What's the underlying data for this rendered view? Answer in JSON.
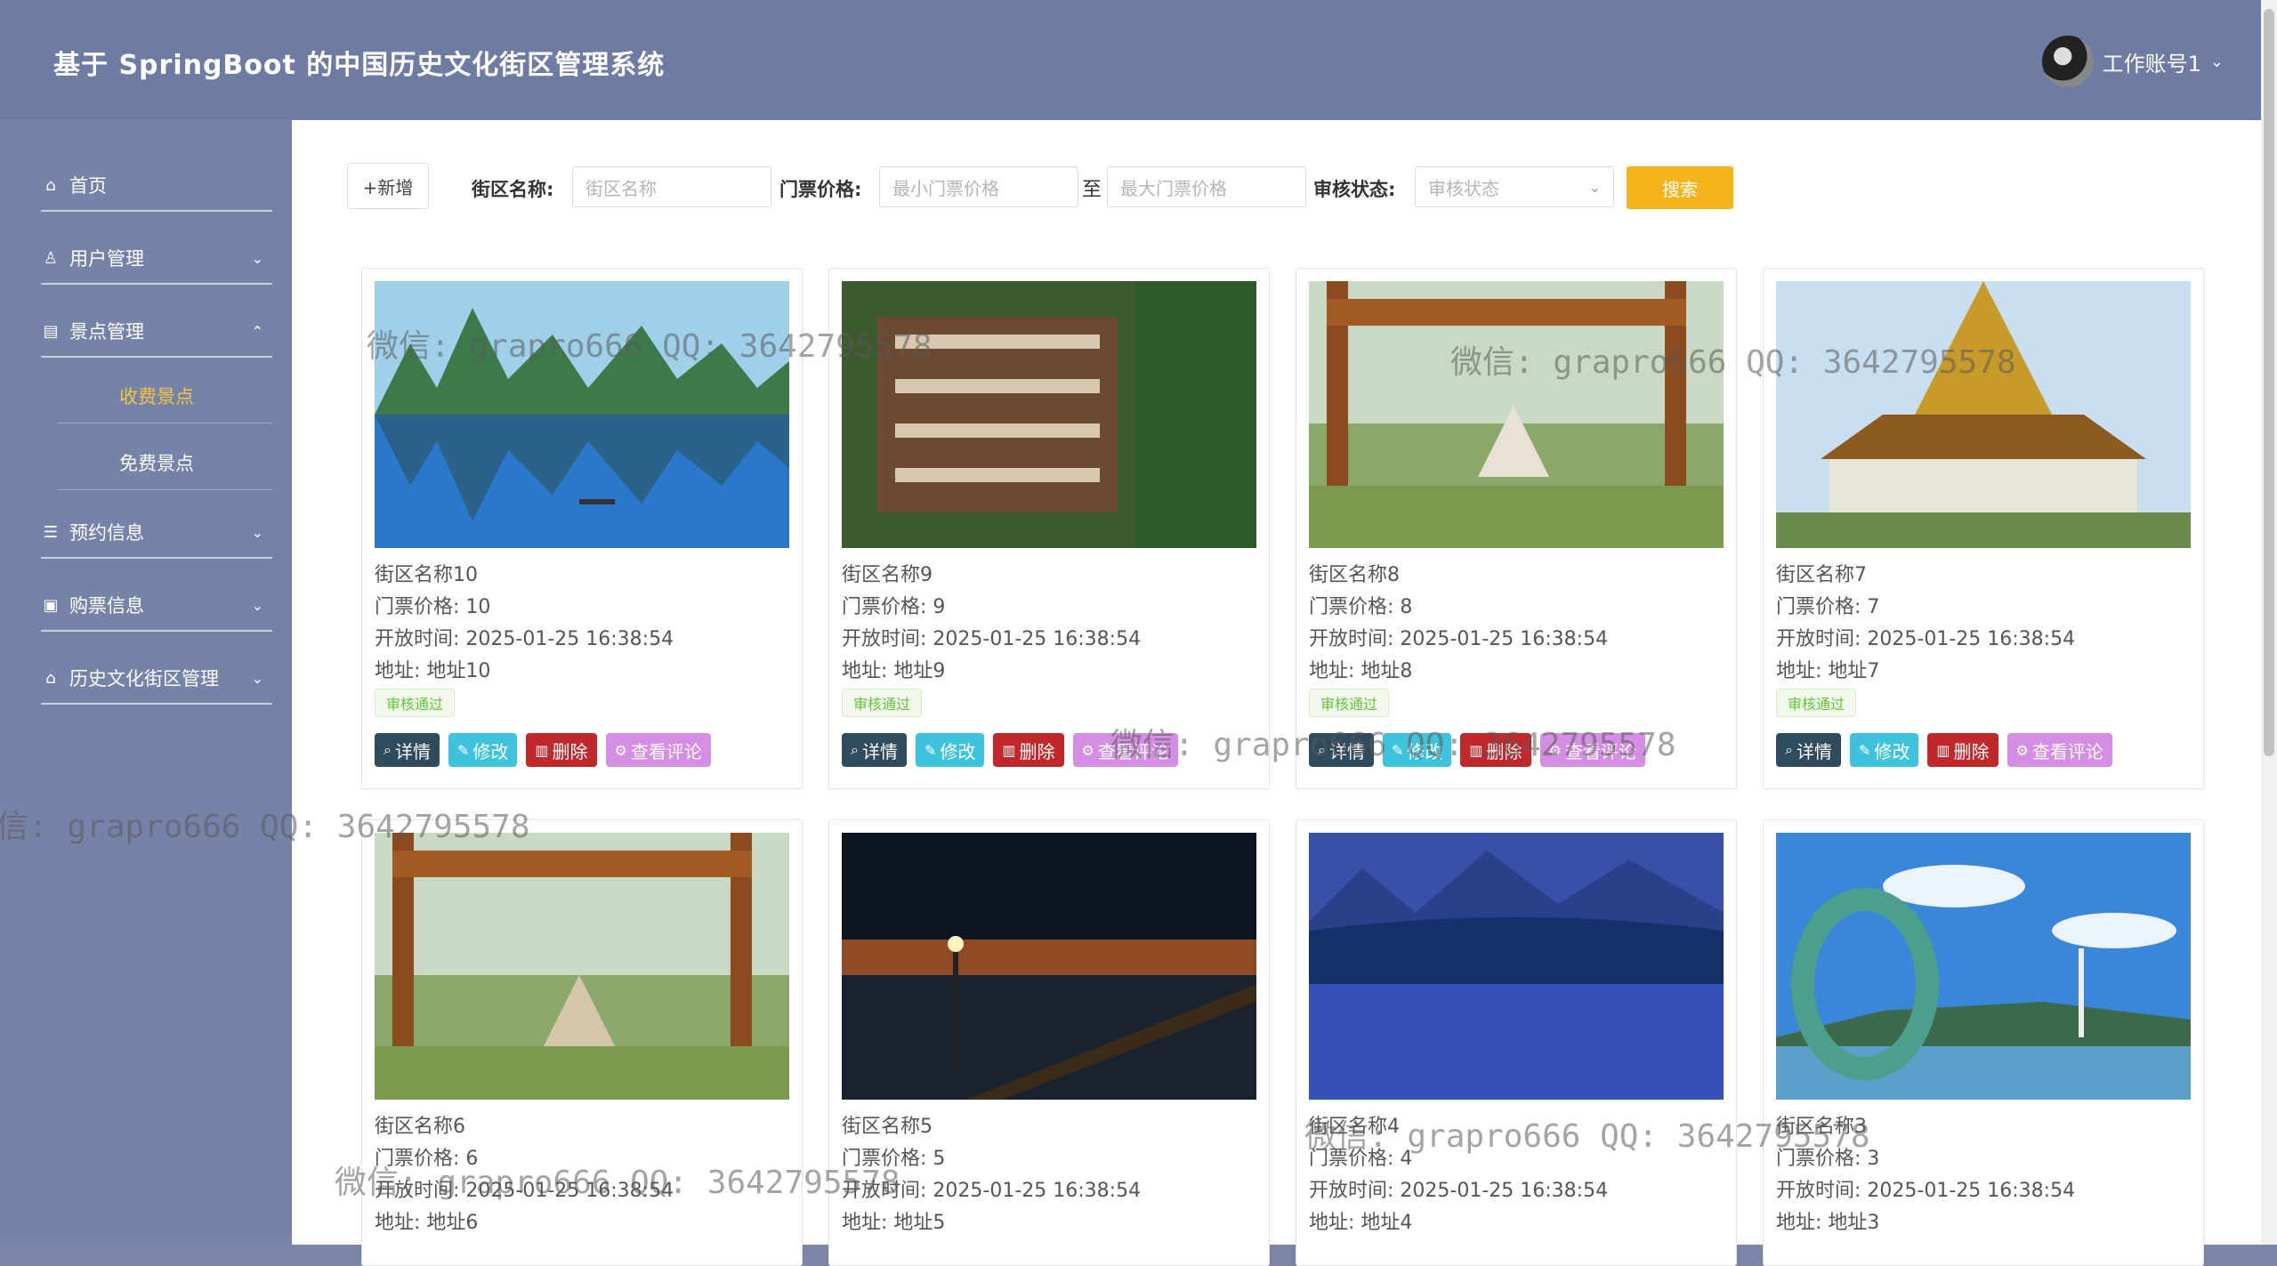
{
  "header": {
    "title": "基于 SpringBoot 的中国历史文化街区管理系统",
    "user": "工作账号1"
  },
  "sidebar": {
    "items": [
      {
        "label": "首页",
        "icon": "home-icon"
      },
      {
        "label": "用户管理",
        "icon": "user-icon"
      },
      {
        "label": "景点管理",
        "icon": "folder-icon"
      },
      {
        "label": "预约信息",
        "icon": "list-icon"
      },
      {
        "label": "购票信息",
        "icon": "ticket-icon"
      },
      {
        "label": "历史文化街区管理",
        "icon": "building-icon"
      }
    ],
    "sub_items": [
      {
        "label": "收费景点",
        "active": true
      },
      {
        "label": "免费景点",
        "active": false
      }
    ]
  },
  "toolbar": {
    "add_label": "+新增",
    "name_label": "街区名称:",
    "name_placeholder": "街区名称",
    "price_label": "门票价格:",
    "min_placeholder": "最小门票价格",
    "to": "至",
    "max_placeholder": "最大门票价格",
    "status_label": "审核状态:",
    "status_placeholder": "审核状态",
    "search_label": "搜索"
  },
  "card_labels": {
    "price": "门票价格:",
    "time": "开放时间:",
    "address": "地址:",
    "badge": "审核通过",
    "detail": "详情",
    "edit": "修改",
    "delete": "删除",
    "comment": "查看评论"
  },
  "cards": [
    {
      "name": "街区名称10",
      "price": "10",
      "time": "2025-01-25 16:38:54",
      "address": "地址10"
    },
    {
      "name": "街区名称9",
      "price": "9",
      "time": "2025-01-25 16:38:54",
      "address": "地址9"
    },
    {
      "name": "街区名称8",
      "price": "8",
      "time": "2025-01-25 16:38:54",
      "address": "地址8"
    },
    {
      "name": "街区名称7",
      "price": "7",
      "time": "2025-01-25 16:38:54",
      "address": "地址7"
    },
    {
      "name": "街区名称6",
      "price": "6",
      "time": "2025-01-25 16:38:54",
      "address": "地址6"
    },
    {
      "name": "街区名称5",
      "price": "5",
      "time": "2025-01-25 16:38:54",
      "address": "地址5"
    },
    {
      "name": "街区名称4",
      "price": "4",
      "time": "2025-01-25 16:38:54",
      "address": "地址4"
    },
    {
      "name": "街区名称3",
      "price": "3",
      "time": "2025-01-25 16:38:54",
      "address": "地址3"
    }
  ],
  "watermark": "微信: grapro666 QQ: 3642795578",
  "colors": {
    "accent": "#f5b31c",
    "header": "#6e7ba3",
    "sidebar": "#7683a8"
  }
}
